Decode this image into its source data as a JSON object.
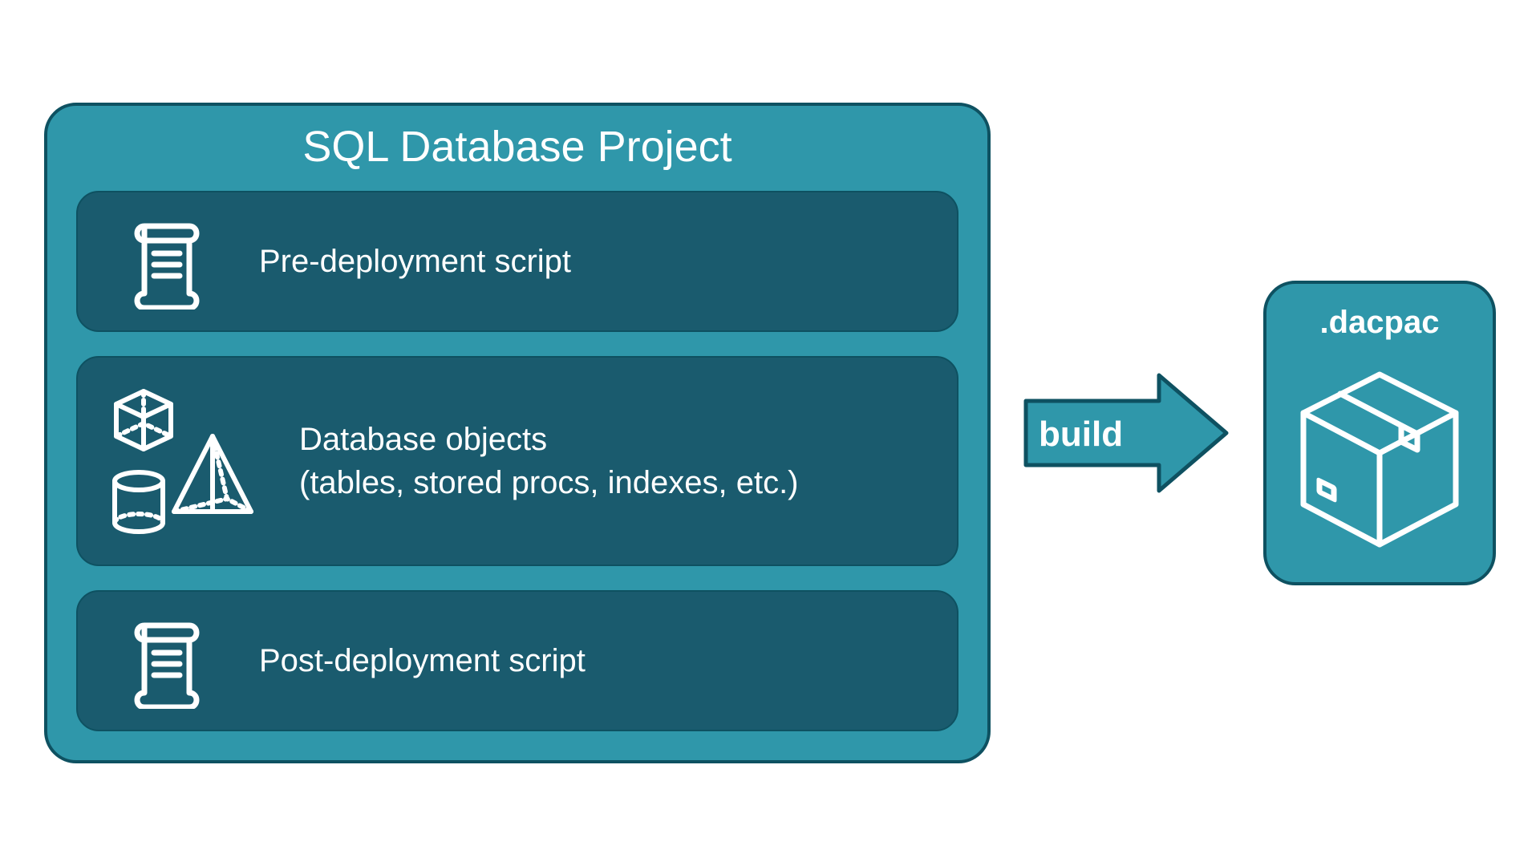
{
  "project": {
    "title": "SQL Database Project",
    "panels": {
      "pre": {
        "label": "Pre-deployment script"
      },
      "objects": {
        "line1": "Database objects",
        "line2": "(tables, stored procs, indexes, etc.)"
      },
      "post": {
        "label": "Post-deployment script"
      }
    }
  },
  "arrow": {
    "label": "build"
  },
  "output": {
    "label": ".dacpac"
  },
  "colors": {
    "containerFill": "#2f97aa",
    "containerBorder": "#0e5161",
    "panelFill": "#1a5b6e",
    "iconStroke": "#ffffff",
    "text": "#ffffff"
  }
}
